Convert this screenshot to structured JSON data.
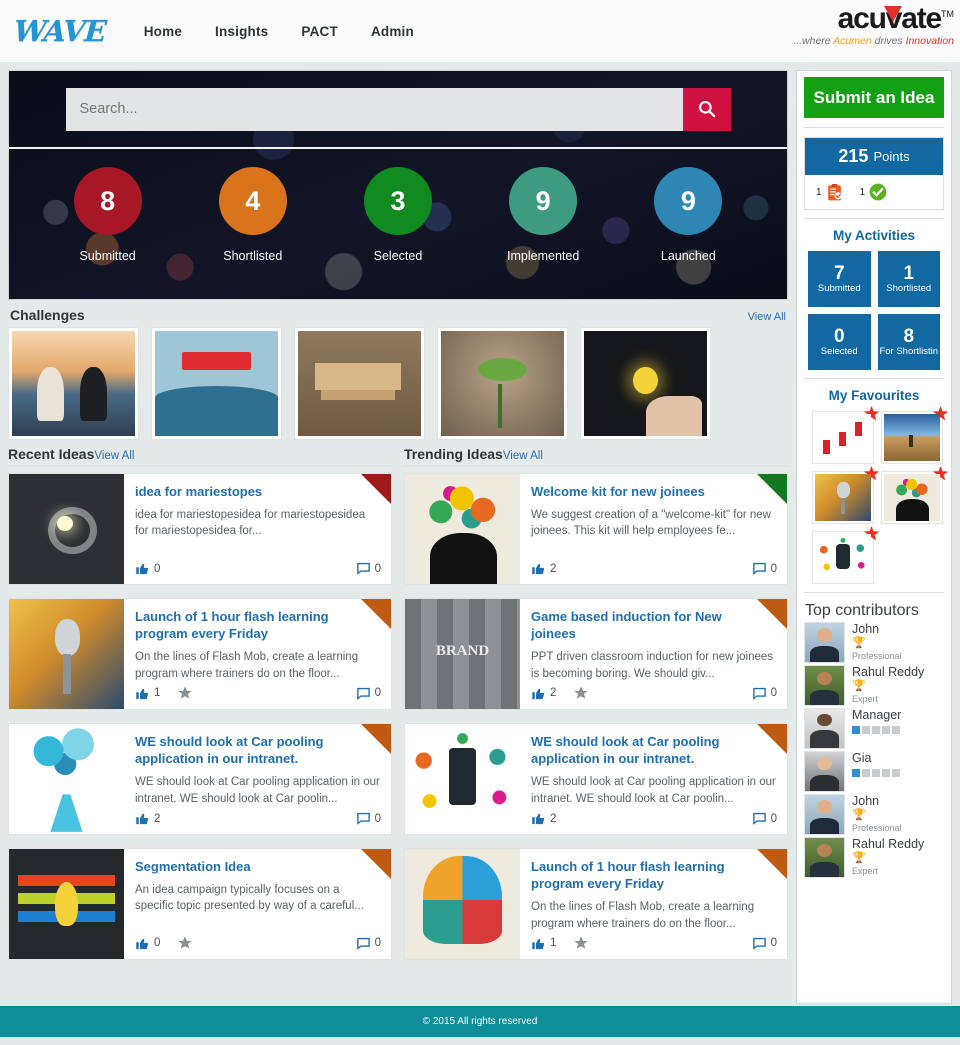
{
  "header": {
    "logo_text": "WAVE",
    "nav": [
      {
        "label": "Home"
      },
      {
        "label": "Insights"
      },
      {
        "label": "PACT"
      },
      {
        "label": "Admin"
      }
    ],
    "brand": {
      "part1": "acu",
      "part_v": "v",
      "part2": "ate",
      "tm": "TM",
      "tagline_pre": "...where ",
      "tagline_amber": "Acumen",
      "tagline_mid": " drives ",
      "tagline_red": "Innovation"
    }
  },
  "search": {
    "placeholder": "Search...",
    "value": "",
    "button_icon": "search-icon"
  },
  "stats": [
    {
      "value": "8",
      "label": "Submitted",
      "color": "#a71725"
    },
    {
      "value": "4",
      "label": "Shortlisted",
      "color": "#d9741c"
    },
    {
      "value": "3",
      "label": "Selected",
      "color": "#118a20"
    },
    {
      "value": "9",
      "label": "Implemented",
      "color": "#3f9b80"
    },
    {
      "value": "9",
      "label": "Launched",
      "color": "#2e86b4"
    }
  ],
  "challenges": {
    "title": "Challenges",
    "view_all": "View All",
    "items": [
      {
        "art": "a-chess",
        "alt": "chess-pieces-image"
      },
      {
        "art": "a-signpost",
        "alt": "signpost-decision-image"
      },
      {
        "art": "a-blocks",
        "alt": "wooden-blocks-image"
      },
      {
        "art": "a-sprout",
        "alt": "sprout-growth-image"
      },
      {
        "art": "a-bulbs",
        "alt": "light-bulbs-image"
      }
    ]
  },
  "recent": {
    "title": "Recent Ideas",
    "view_all": "View All",
    "cards": [
      {
        "title": "idea for mariestopes",
        "desc": "idea for mariestopesidea for mariestopesidea for mariestopesidea for...",
        "likes": "0",
        "comments": "0",
        "ribbon": "",
        "star": false,
        "art": "a-gears"
      },
      {
        "title": "Launch of 1 hour flash learning program every Friday",
        "desc": "On the lines of Flash Mob, create a learning program where trainers do on the floor...",
        "likes": "1",
        "comments": "0",
        "ribbon": "orange",
        "star": true,
        "art": "a-mic"
      },
      {
        "title": "WE should look at Car pooling application in our intranet.",
        "desc": "WE should look at Car pooling application in our intranet. WE should look at Car poolin...",
        "likes": "2",
        "comments": "0",
        "ribbon": "orange",
        "star": false,
        "art": "a-flask"
      },
      {
        "title": "Segmentation Idea",
        "desc": "An idea campaign typically focuses on a specific topic presented by way of a careful...",
        "likes": "0",
        "comments": "0",
        "ribbon": "orange",
        "star": true,
        "art": "a-seg"
      }
    ]
  },
  "trending": {
    "title": "Trending Ideas",
    "view_all": "View All",
    "cards": [
      {
        "title": "Welcome kit for new joinees",
        "desc": "We suggest creation of a \"welcome-kit\" for new joinees. This kit will help employees fe...",
        "likes": "2",
        "comments": "0",
        "ribbon": "green",
        "star": false,
        "art": "a-head"
      },
      {
        "title": "Game based induction for New joinees",
        "desc": "PPT driven classroom induction for new joinees is becoming boring. We should giv...",
        "likes": "2",
        "comments": "0",
        "ribbon": "orange",
        "star": true,
        "art": "a-brand"
      },
      {
        "title": "WE should look at Car pooling application in our intranet.",
        "desc": "WE should look at Car pooling application in our intranet. WE should look at Car poolin...",
        "likes": "2",
        "comments": "0",
        "ribbon": "orange",
        "star": false,
        "art": "a-mobile"
      },
      {
        "title": "Launch of 1 hour flash learning program every Friday",
        "desc": "On the lines of Flash Mob, create a learning program where trainers do on the floor...",
        "likes": "1",
        "comments": "0",
        "ribbon": "orange",
        "star": true,
        "art": "a-think"
      }
    ]
  },
  "sidebar": {
    "submit_label": "Submit an Idea",
    "points": {
      "value": "215",
      "word": "Points",
      "badges": [
        {
          "count": "1",
          "icon": "clipboard-check-icon"
        },
        {
          "count": "1",
          "icon": "circle-check-icon"
        }
      ]
    },
    "activities": {
      "title": "My Activities",
      "tiles": [
        {
          "value": "7",
          "label": "Submitted"
        },
        {
          "value": "1",
          "label": "Shortlisted"
        },
        {
          "value": "0",
          "label": "Selected"
        },
        {
          "value": "8",
          "label": "For Shortlistin"
        }
      ]
    },
    "favourites": {
      "title": "My Favourites",
      "items": [
        {
          "art": "a-rocket",
          "alt": "growth-chart-rocket-image"
        },
        {
          "art": "a-desert",
          "alt": "desert-road-image"
        },
        {
          "art": "a-mic",
          "alt": "microphone-image"
        },
        {
          "art": "a-head",
          "alt": "colorful-head-image"
        },
        {
          "art": "a-mobile",
          "alt": "mobile-app-image"
        }
      ]
    },
    "contributors": {
      "title": "Top contributors",
      "items": [
        {
          "name": "John",
          "rank": "Professional",
          "type": "rosette",
          "bars": 0,
          "art": "a-john"
        },
        {
          "name": "Rahul Reddy",
          "rank": "Expert",
          "type": "rosette",
          "bars": 0,
          "art": "a-rahul"
        },
        {
          "name": "Manager",
          "rank": "",
          "type": "bars",
          "bars": 1,
          "art": "a-mgr"
        },
        {
          "name": "Gia",
          "rank": "",
          "type": "bars",
          "bars": 1,
          "art": "a-gia"
        },
        {
          "name": "John",
          "rank": "Professional",
          "type": "rosette",
          "bars": 0,
          "art": "a-john"
        },
        {
          "name": "Rahul Reddy",
          "rank": "Expert",
          "type": "rosette",
          "bars": 0,
          "art": "a-rahul"
        }
      ]
    }
  },
  "footer": {
    "text": "© 2015 All rights reserved"
  },
  "colors": {
    "accent_blue": "#1268a0",
    "submit_green": "#14a014",
    "search_btn": "#ce1141",
    "footer_teal": "#0d8e99",
    "ribbon_red": "#9e1b1b",
    "ribbon_green": "#14781f",
    "ribbon_orange": "#bf5a12"
  }
}
